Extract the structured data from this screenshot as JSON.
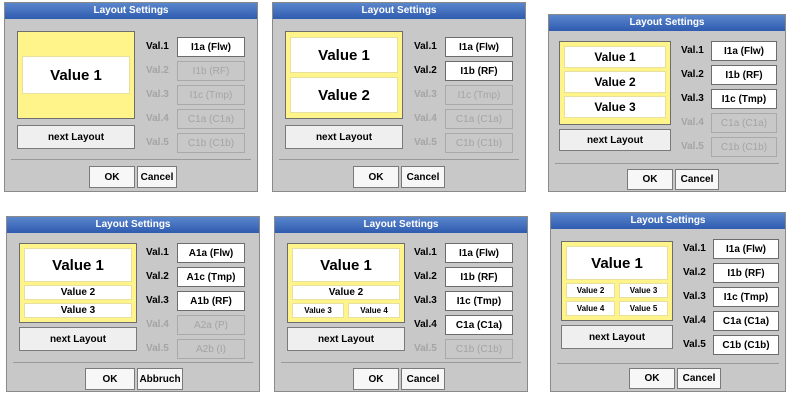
{
  "panels": [
    {
      "title": "Layout Settings",
      "preview": [
        "Value 1"
      ],
      "vals": [
        {
          "label": "Val.1",
          "value": "I1a (Flw)",
          "active": true
        },
        {
          "label": "Val.2",
          "value": "I1b (RF)",
          "active": false
        },
        {
          "label": "Val.3",
          "value": "I1c (Tmp)",
          "active": false
        },
        {
          "label": "Val.4",
          "value": "C1a (C1a)",
          "active": false
        },
        {
          "label": "Val.5",
          "value": "C1b (C1b)",
          "active": false
        }
      ],
      "next_label": "next Layout",
      "ok_label": "OK",
      "cancel_label": "Cancel"
    },
    {
      "title": "Layout Settings",
      "preview": [
        "Value 1",
        "Value 2"
      ],
      "vals": [
        {
          "label": "Val.1",
          "value": "I1a (Flw)",
          "active": true
        },
        {
          "label": "Val.2",
          "value": "I1b (RF)",
          "active": true
        },
        {
          "label": "Val.3",
          "value": "I1c (Tmp)",
          "active": false
        },
        {
          "label": "Val.4",
          "value": "C1a (C1a)",
          "active": false
        },
        {
          "label": "Val.5",
          "value": "C1b (C1b)",
          "active": false
        }
      ],
      "next_label": "next Layout",
      "ok_label": "OK",
      "cancel_label": "Cancel"
    },
    {
      "title": "Layout Settings",
      "preview": [
        "Value 1",
        "Value 2",
        "Value 3"
      ],
      "vals": [
        {
          "label": "Val.1",
          "value": "I1a (Flw)",
          "active": true
        },
        {
          "label": "Val.2",
          "value": "I1b (RF)",
          "active": true
        },
        {
          "label": "Val.3",
          "value": "I1c (Tmp)",
          "active": true
        },
        {
          "label": "Val.4",
          "value": "C1a (C1a)",
          "active": false
        },
        {
          "label": "Val.5",
          "value": "C1b (C1b)",
          "active": false
        }
      ],
      "next_label": "next Layout",
      "ok_label": "OK",
      "cancel_label": "Cancel"
    },
    {
      "title": "Layout Settings",
      "preview": [
        "Value 1",
        "Value 2",
        "Value 3"
      ],
      "vals": [
        {
          "label": "Val.1",
          "value": "A1a (Flw)",
          "active": true
        },
        {
          "label": "Val.2",
          "value": "A1c (Tmp)",
          "active": true
        },
        {
          "label": "Val.3",
          "value": "A1b (RF)",
          "active": true
        },
        {
          "label": "Val.4",
          "value": "A2a (P)",
          "active": false
        },
        {
          "label": "Val.5",
          "value": "A2b (I)",
          "active": false
        }
      ],
      "next_label": "next Layout",
      "ok_label": "OK",
      "cancel_label": "Abbruch"
    },
    {
      "title": "Layout Settings",
      "preview": [
        "Value 1",
        "Value 2",
        "Value 3",
        "Value 4"
      ],
      "vals": [
        {
          "label": "Val.1",
          "value": "I1a (Flw)",
          "active": true
        },
        {
          "label": "Val.2",
          "value": "I1b (RF)",
          "active": true
        },
        {
          "label": "Val.3",
          "value": "I1c (Tmp)",
          "active": true
        },
        {
          "label": "Val.4",
          "value": "C1a (C1a)",
          "active": true
        },
        {
          "label": "Val.5",
          "value": "C1b (C1b)",
          "active": false
        }
      ],
      "next_label": "next Layout",
      "ok_label": "OK",
      "cancel_label": "Cancel"
    },
    {
      "title": "Layout Settings",
      "preview": [
        "Value 1",
        "Value 2",
        "Value 3",
        "Value 4",
        "Value 5"
      ],
      "vals": [
        {
          "label": "Val.1",
          "value": "I1a (Flw)",
          "active": true
        },
        {
          "label": "Val.2",
          "value": "I1b (RF)",
          "active": true
        },
        {
          "label": "Val.3",
          "value": "I1c (Tmp)",
          "active": true
        },
        {
          "label": "Val.4",
          "value": "C1a (C1a)",
          "active": true
        },
        {
          "label": "Val.5",
          "value": "C1b (C1b)",
          "active": true
        }
      ],
      "next_label": "next Layout",
      "ok_label": "OK",
      "cancel_label": "Cancel"
    }
  ],
  "colors": {
    "title_bar": "#3a67bd",
    "panel_bg": "#c8c8c8",
    "preview_bg": "#fff48a",
    "disabled_text": "#a4a4a4"
  }
}
